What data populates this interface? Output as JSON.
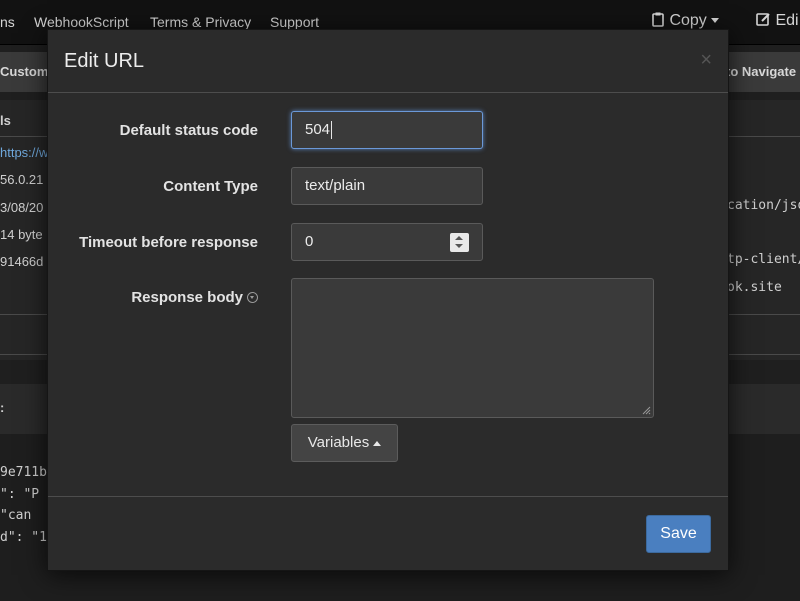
{
  "nav": {
    "links": [
      "ns",
      "WebhookScript",
      "Terms & Privacy",
      "Support"
    ],
    "copy_label": "Copy",
    "edit_label": "Edi"
  },
  "subbar": {
    "left_label": "Custom A",
    "right_label": "to Navigate"
  },
  "background": {
    "section_label": "ls",
    "detail_lines": [
      "https://w",
      "56.0.21",
      "3/08/20",
      "14 byte",
      "91466d"
    ],
    "right_lines": [
      "cation/jso",
      "tp-client/",
      "ok.site"
    ],
    "lower_label": ":",
    "code_lines": [
      "9e711b",
      "\": \"P",
      "\"can",
      "d\": \"1"
    ]
  },
  "modal": {
    "title": "Edit URL",
    "close_symbol": "×",
    "fields": {
      "status_code": {
        "label": "Default status code",
        "value": "504"
      },
      "content_type": {
        "label": "Content Type",
        "value": "text/plain"
      },
      "timeout": {
        "label": "Timeout before response",
        "value": "0"
      },
      "response_body": {
        "label": "Response body",
        "value": ""
      }
    },
    "variables_button": "Variables",
    "save_button": "Save"
  },
  "colors": {
    "accent": "#4a7fc0",
    "focus_ring": "#6b99d8"
  }
}
